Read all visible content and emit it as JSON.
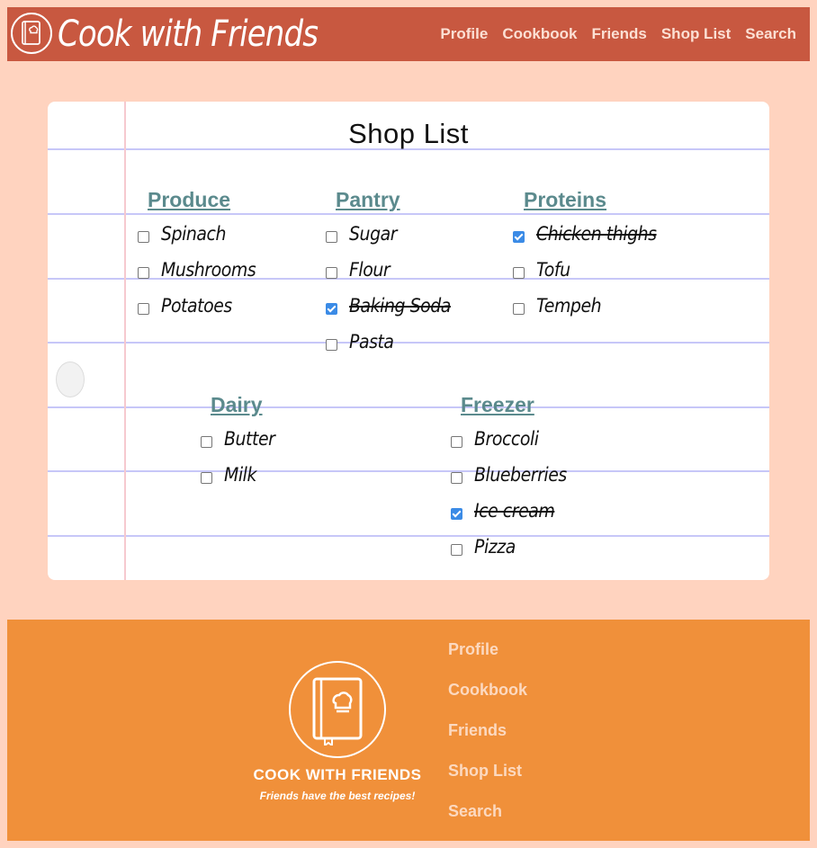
{
  "header": {
    "brand": "Cook with Friends",
    "nav": [
      "Profile",
      "Cookbook",
      "Friends",
      "Shop List",
      "Search"
    ]
  },
  "page": {
    "title": "Shop List",
    "categories": [
      {
        "name": "Produce",
        "items": [
          {
            "label": "Spinach",
            "checked": false
          },
          {
            "label": "Mushrooms",
            "checked": false
          },
          {
            "label": "Potatoes",
            "checked": false
          }
        ]
      },
      {
        "name": "Pantry",
        "items": [
          {
            "label": "Sugar",
            "checked": false
          },
          {
            "label": "Flour",
            "checked": false
          },
          {
            "label": "Baking Soda",
            "checked": true
          },
          {
            "label": "Pasta",
            "checked": false
          }
        ]
      },
      {
        "name": "Proteins",
        "items": [
          {
            "label": "Chicken thighs",
            "checked": true
          },
          {
            "label": "Tofu",
            "checked": false
          },
          {
            "label": "Tempeh",
            "checked": false
          }
        ]
      },
      {
        "name": "Dairy",
        "items": [
          {
            "label": "Butter",
            "checked": false
          },
          {
            "label": "Milk",
            "checked": false
          }
        ]
      },
      {
        "name": "Freezer",
        "items": [
          {
            "label": "Broccoli",
            "checked": false
          },
          {
            "label": "Blueberries",
            "checked": false
          },
          {
            "label": "Ice cream",
            "checked": true
          },
          {
            "label": "Pizza",
            "checked": false
          }
        ]
      }
    ]
  },
  "footer": {
    "brand": "COOK WITH FRIENDS",
    "tagline": "Friends have the best recipes!",
    "nav": [
      "Profile",
      "Cookbook",
      "Friends",
      "Shop List",
      "Search"
    ]
  },
  "colors": {
    "background": "#ffd3bf",
    "header": "#c85840",
    "footer": "#f0903a",
    "category": "#5b8a8d",
    "checkbox_checked": "#3b8be6"
  },
  "icons": {
    "logo": "cookbook-chef-hat-icon"
  }
}
